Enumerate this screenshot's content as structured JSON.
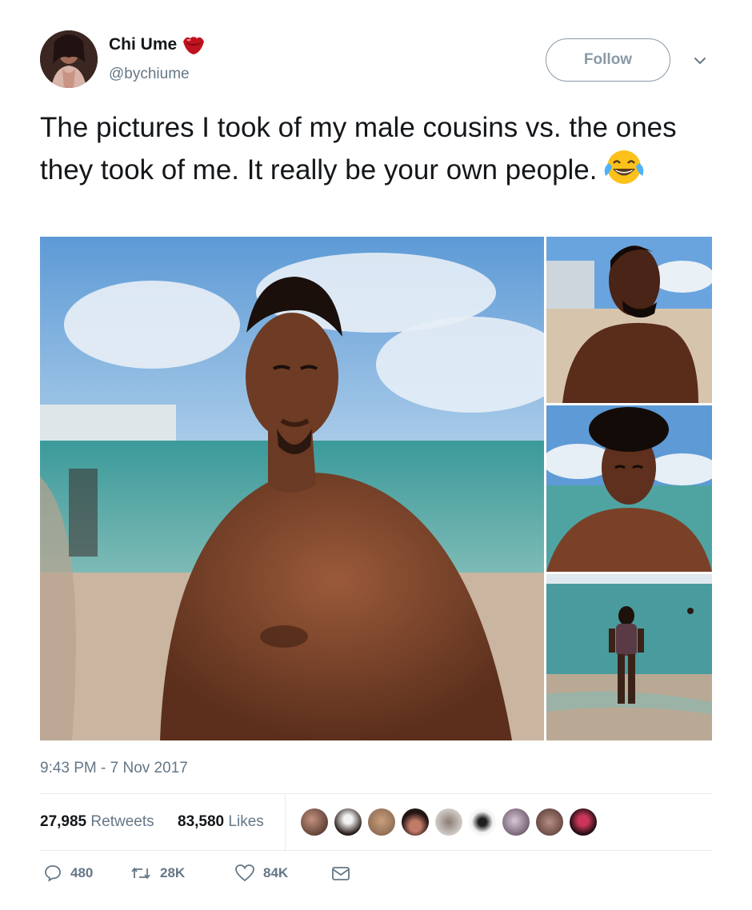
{
  "author": {
    "display_name": "Chi Ume",
    "handle": "@bychiume",
    "name_emoji": "lips-emoji"
  },
  "header": {
    "follow_label": "Follow",
    "menu_icon": "chevron-down-icon"
  },
  "tweet": {
    "text": "The pictures I took of my male cousins vs. the ones they took of me. It really be your own people.",
    "text_emoji": "tears-of-joy-emoji",
    "timestamp": "9:43 PM - 7 Nov 2017"
  },
  "media": {
    "photos": [
      "beach-portrait-large",
      "beach-profile",
      "beach-portrait-curly",
      "beach-distant-woman"
    ]
  },
  "stats": {
    "retweets_count": "27,985",
    "retweets_label": "Retweets",
    "likes_count": "83,580",
    "likes_label": "Likes",
    "liker_avatars": 10
  },
  "actions": {
    "reply_count": "480",
    "retweet_count": "28K",
    "like_count": "84K"
  },
  "colors": {
    "text_primary": "#14171a",
    "text_secondary": "#657786",
    "border": "#e6ecf0",
    "follow_border": "#8899a6"
  }
}
